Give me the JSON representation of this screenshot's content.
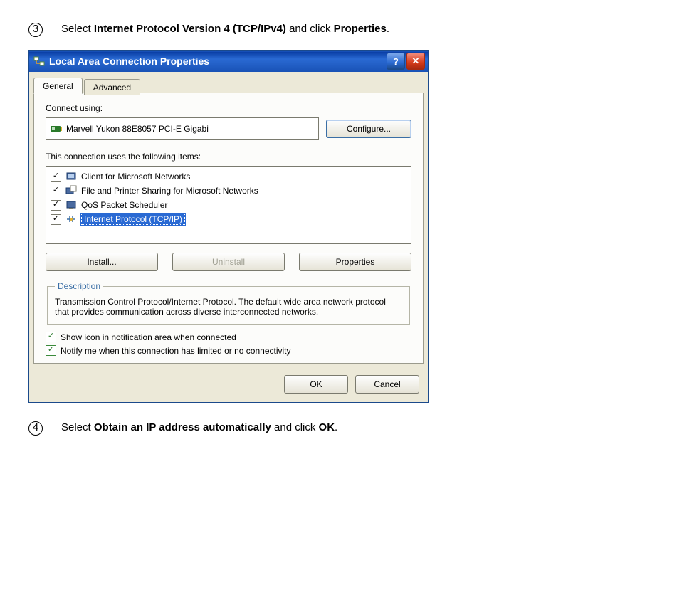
{
  "step3": {
    "num": "3",
    "text_pre": "Select ",
    "bold1": "Internet Protocol Version 4 (TCP/IPv4)",
    "text_mid": " and click ",
    "bold2": "Properties",
    "text_end": "."
  },
  "step4": {
    "num": "4",
    "text_pre": "Select ",
    "bold1": "Obtain an IP address automatically",
    "text_mid": " and click ",
    "bold2": "OK",
    "text_end": "."
  },
  "dialog": {
    "title": "Local Area Connection Properties",
    "help_glyph": "?",
    "close_glyph": "✕",
    "tabs": {
      "general": "General",
      "advanced": "Advanced"
    },
    "connect_using_label": "Connect using:",
    "adapter_name": "Marvell Yukon 88E8057 PCI-E Gigabi",
    "configure_btn": "Configure...",
    "items_label": "This connection uses the following items:",
    "items": [
      {
        "label": "Client for Microsoft Networks",
        "checked": true,
        "selected": false
      },
      {
        "label": "File and Printer Sharing for Microsoft Networks",
        "checked": true,
        "selected": false
      },
      {
        "label": "QoS Packet Scheduler",
        "checked": true,
        "selected": false
      },
      {
        "label": "Internet Protocol (TCP/IP)",
        "checked": true,
        "selected": true
      }
    ],
    "install_btn": "Install...",
    "uninstall_btn": "Uninstall",
    "properties_btn": "Properties",
    "desc_legend": "Description",
    "desc_text": "Transmission Control Protocol/Internet Protocol. The default wide area network protocol that provides communication across diverse interconnected networks.",
    "show_icon_label": "Show icon in notification area when connected",
    "notify_label": "Notify me when this connection has limited or no connectivity",
    "ok_btn": "OK",
    "cancel_btn": "Cancel"
  }
}
